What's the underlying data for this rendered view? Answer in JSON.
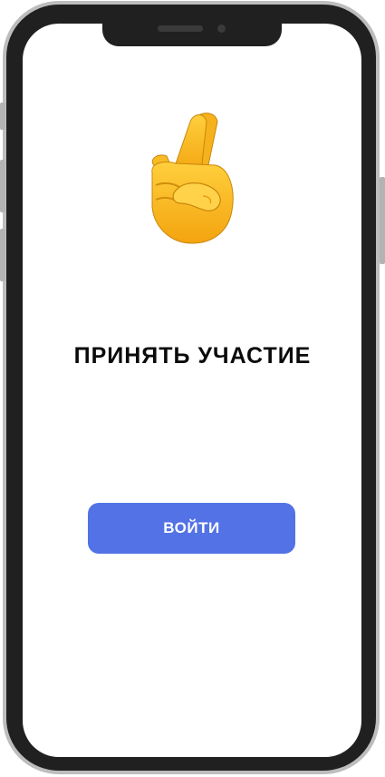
{
  "screen": {
    "illustration_icon": "crossed-fingers-icon",
    "title": "ПРИНЯТЬ УЧАСТИЕ",
    "login_button_label": "ВОЙТИ",
    "accent_color": "#5272e5"
  }
}
